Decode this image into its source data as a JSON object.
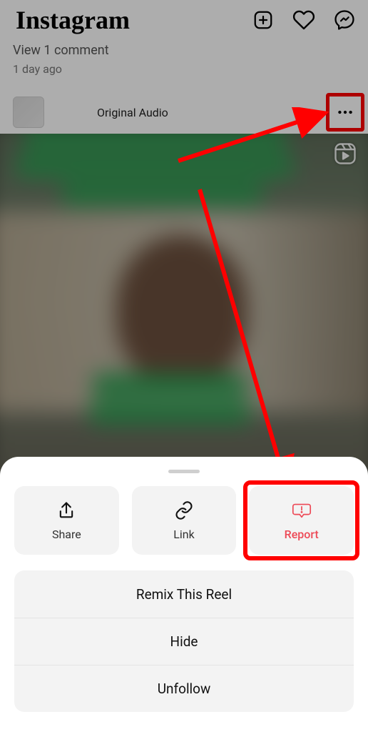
{
  "header": {
    "logo_text": "Instagram"
  },
  "post_meta": {
    "comments_label": "View 1 comment",
    "timestamp": "1 day ago"
  },
  "audio": {
    "label": "Original Audio"
  },
  "sheet": {
    "tiles": {
      "share": "Share",
      "link": "Link",
      "report": "Report"
    },
    "items": [
      "Remix This Reel",
      "Hide",
      "Unfollow"
    ]
  },
  "colors": {
    "danger": "#ed4956",
    "highlight": "#ff0000"
  }
}
